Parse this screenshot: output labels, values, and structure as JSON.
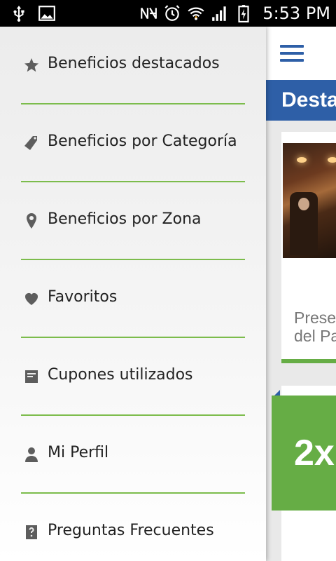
{
  "status_bar": {
    "time": "5:53 PM",
    "icons": [
      "usb-icon",
      "image-icon",
      "nfc-icon",
      "alarm-icon",
      "wifi-icon",
      "signal-icon",
      "battery-charging-icon"
    ]
  },
  "colors": {
    "brand_blue": "#2e5fa7",
    "brand_green": "#66ad45",
    "divider_green": "#7cbc4c"
  },
  "drawer": {
    "items": [
      {
        "label": "Beneficios destacados",
        "icon": "star-icon"
      },
      {
        "label": "Beneficios por Categoría",
        "icon": "tag-icon"
      },
      {
        "label": "Beneficios por Zona",
        "icon": "location-pin-icon"
      },
      {
        "label": "Favoritos",
        "icon": "heart-icon"
      },
      {
        "label": "Cupones utilizados",
        "icon": "coupon-icon"
      },
      {
        "label": "Mi Perfil",
        "icon": "person-icon"
      },
      {
        "label": "Preguntas Frecuentes",
        "icon": "faq-icon"
      }
    ]
  },
  "main": {
    "section_title": "Desta",
    "card1_text_line1": "Preser",
    "card1_text_line2": "del Pa",
    "card2_badge": "2x"
  }
}
